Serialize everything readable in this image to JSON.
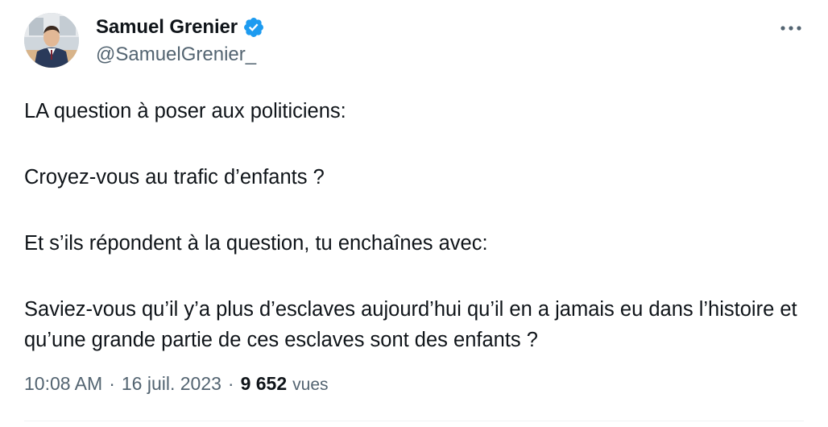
{
  "author": {
    "display_name": "Samuel Grenier",
    "handle": "@SamuelGrenier_",
    "verified": true,
    "avatar_icon": "profile-photo"
  },
  "icons": {
    "verified": "verified-badge-icon",
    "more": "more-horizontal-icon"
  },
  "colors": {
    "verified_blue": "#1d9bf0",
    "text_primary": "#0f1419",
    "text_secondary": "#536471"
  },
  "tweet": {
    "paragraphs": [
      "LA question à poser aux politiciens:",
      "Croyez-vous au trafic d’enfants ?",
      "Et s’ils répondent à la question, tu enchaînes avec:",
      "Saviez-vous qu’il y’a plus d’esclaves aujourd’hui qu’il en a jamais eu dans l’histoire et qu’une grande partie de ces esclaves sont des enfants ?"
    ]
  },
  "meta": {
    "time": "10:08 AM",
    "separator": "·",
    "date": "16 juil. 2023",
    "views_count": "9 652",
    "views_label": "vues"
  }
}
